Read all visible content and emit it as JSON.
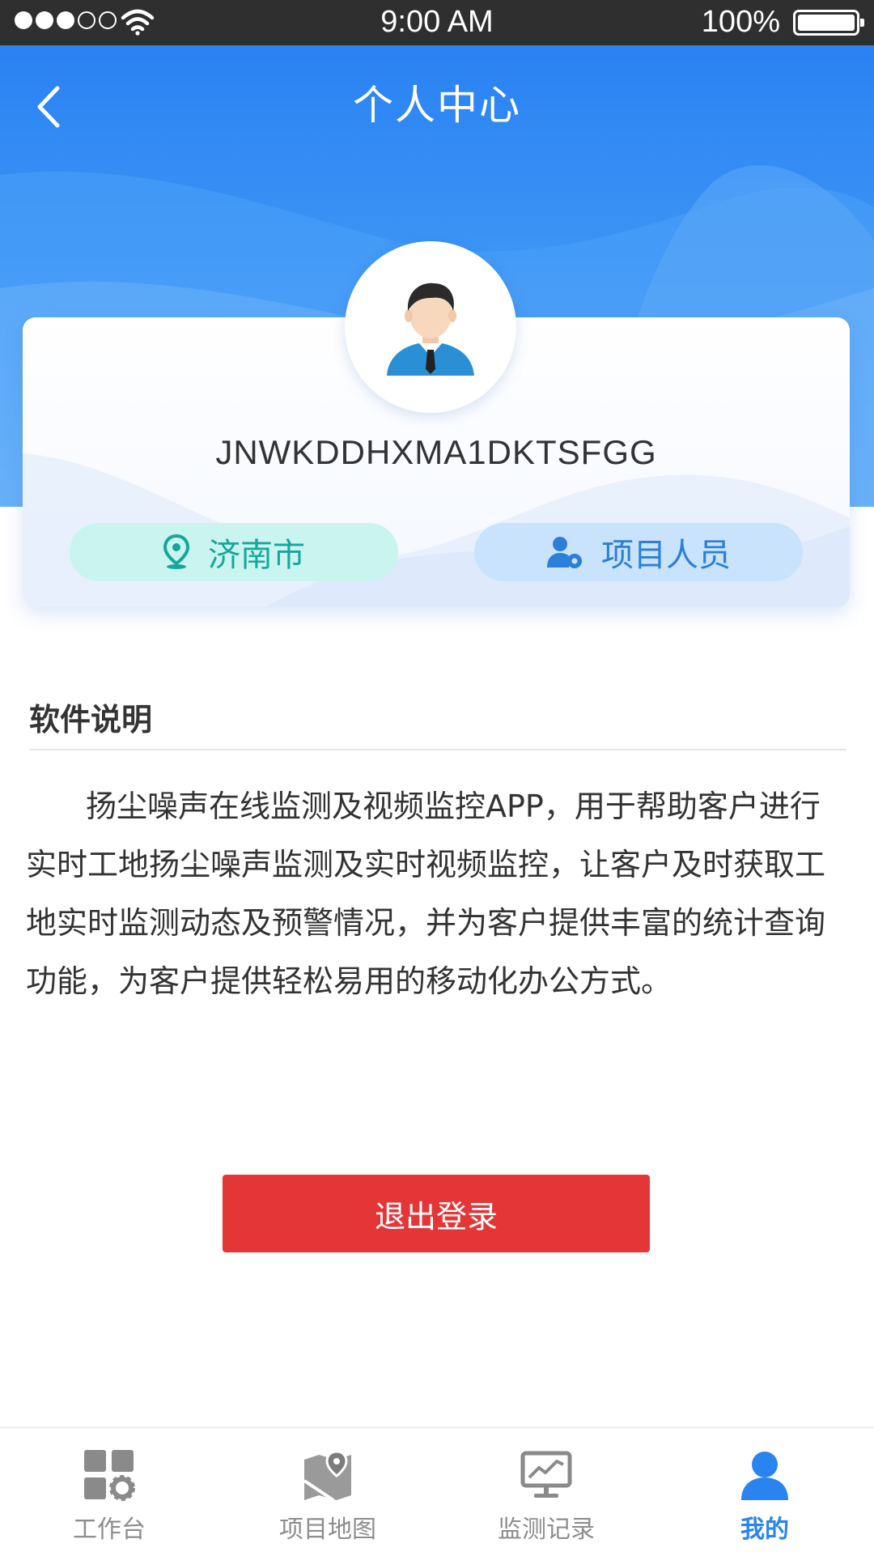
{
  "status_bar": {
    "time": "9:00 AM",
    "battery": "100%"
  },
  "header": {
    "title": "个人中心",
    "back_icon": "chevron-left-icon"
  },
  "profile": {
    "username": "JNWKDDHXMA1DKTSFGG",
    "city": "济南市",
    "role": "项目人员",
    "avatar_icon": "user-avatar-icon"
  },
  "about": {
    "title": "软件说明",
    "text": "扬尘噪声在线监测及视频监控APP，用于帮助客户进行实时工地扬尘噪声监测及实时视频监控，让客户及时获取工地实时监测动态及预警情况，并为客户提供丰富的统计查询功能，为客户提供轻松易用的移动化办公方式。"
  },
  "logout": {
    "label": "退出登录"
  },
  "tabs": [
    {
      "label": "工作台",
      "icon": "dashboard-grid-icon",
      "active": false
    },
    {
      "label": "项目地图",
      "icon": "map-pin-icon",
      "active": false
    },
    {
      "label": "监测记录",
      "icon": "monitor-chart-icon",
      "active": false
    },
    {
      "label": "我的",
      "icon": "user-profile-icon",
      "active": true
    }
  ],
  "colors": {
    "header_blue": "#2a82f3",
    "logout_red": "#e43636",
    "active_tab": "#2a84f0",
    "city_tag_bg": "#c9f4f0",
    "city_tag_text": "#17a79a",
    "role_tag_bg": "#c8e3fb",
    "role_tag_text": "#2b7fd8"
  }
}
